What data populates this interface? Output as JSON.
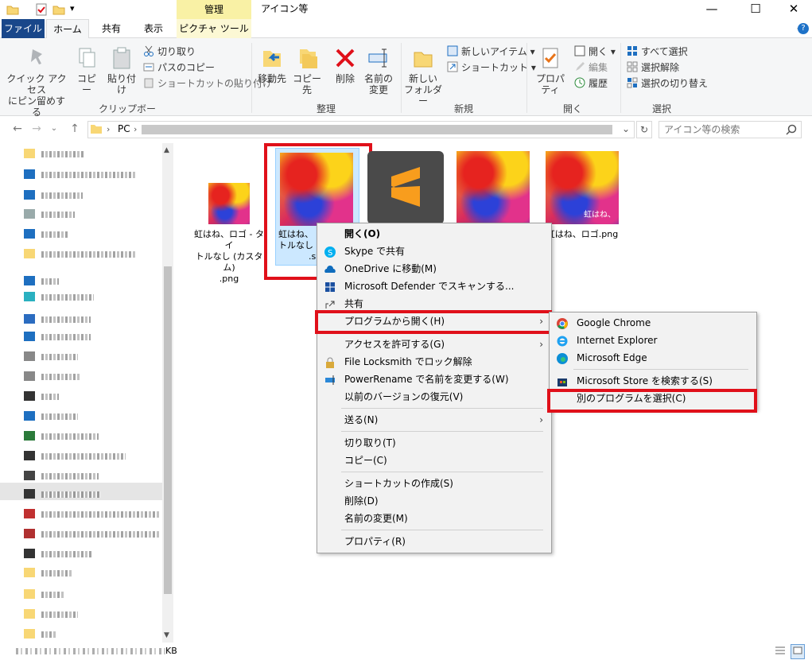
{
  "title_bar": {
    "window_title": "アイコン等",
    "contextual_tab": "管理",
    "minimize": "—",
    "maximize": "☐",
    "close": "✕"
  },
  "tabs": {
    "file": "ファイル",
    "home": "ホーム",
    "share": "共有",
    "view": "表示",
    "picture_tools": "ピクチャ ツール"
  },
  "ribbon": {
    "clipboard": {
      "label": "クリップボード",
      "pin_line1": "クイック アクセス",
      "pin_line2": "にピン留めする",
      "copy": "コピー",
      "paste": "貼り付け",
      "cut": "切り取り",
      "copy_path": "パスのコピー",
      "paste_shortcut": "ショートカットの貼り付け"
    },
    "organize": {
      "label": "整理",
      "move_to": "移動先",
      "copy_to": "コピー先",
      "delete": "削除",
      "rename_line1": "名前の",
      "rename_line2": "変更"
    },
    "new": {
      "label": "新規",
      "new_folder_line1": "新しい",
      "new_folder_line2": "フォルダー",
      "new_item": "新しいアイテム ▾",
      "shortcut": "ショートカット ▾"
    },
    "open": {
      "label": "開く",
      "properties": "プロパティ",
      "open": "開く ▾",
      "edit": "編集",
      "history": "履歴"
    },
    "select": {
      "label": "選択",
      "select_all": "すべて選択",
      "select_none": "選択解除",
      "invert": "選択の切り替え"
    }
  },
  "address": {
    "path_root": "PC",
    "search_placeholder": "アイコン等の検索"
  },
  "files": [
    {
      "name": "虹はね、ロゴ - タイトルなし (カスタム).png"
    },
    {
      "name": "虹はね、ロゴ - タイトルなし.s"
    },
    {
      "name": ""
    },
    {
      "name": ""
    },
    {
      "name": "虹はね、ロゴ.png",
      "overlay": "虹はね、"
    }
  ],
  "file_labels": {
    "f1_l1": "虹はね、ロゴ - タイ",
    "f1_l2": "トルなし (カスタム)",
    "f1_l3": ".png",
    "f2_l1": "虹はね、",
    "f2_l2": "トルなし",
    "f2_l3": ".s",
    "f5_l1": "虹はね、ロゴ.png",
    "f5_overlay": "虹はね、"
  },
  "context_menu": {
    "open": "開く(O)",
    "skype": "Skype で共有",
    "onedrive": "OneDrive に移動(M)",
    "defender": "Microsoft Defender でスキャンする...",
    "share": "共有",
    "open_with": "プログラムから開く(H)",
    "give_access": "アクセスを許可する(G)",
    "locksmith": "File Locksmith でロック解除",
    "powerrename": "PowerRename で名前を変更する(W)",
    "restore": "以前のバージョンの復元(V)",
    "send_to": "送る(N)",
    "cut": "切り取り(T)",
    "copy": "コピー(C)",
    "create_shortcut": "ショートカットの作成(S)",
    "delete": "削除(D)",
    "rename": "名前の変更(M)",
    "properties": "プロパティ(R)"
  },
  "submenu": {
    "chrome": "Google Chrome",
    "ie": "Internet Explorer",
    "edge": "Microsoft Edge",
    "store": "Microsoft Store を検索する(S)",
    "choose": "別のプログラムを選択(C)"
  },
  "status": {
    "size_suffix": "KB"
  },
  "colors": {
    "accent_red": "#e0101a",
    "file_tab": "#19478a",
    "selection": "#cce8ff"
  }
}
